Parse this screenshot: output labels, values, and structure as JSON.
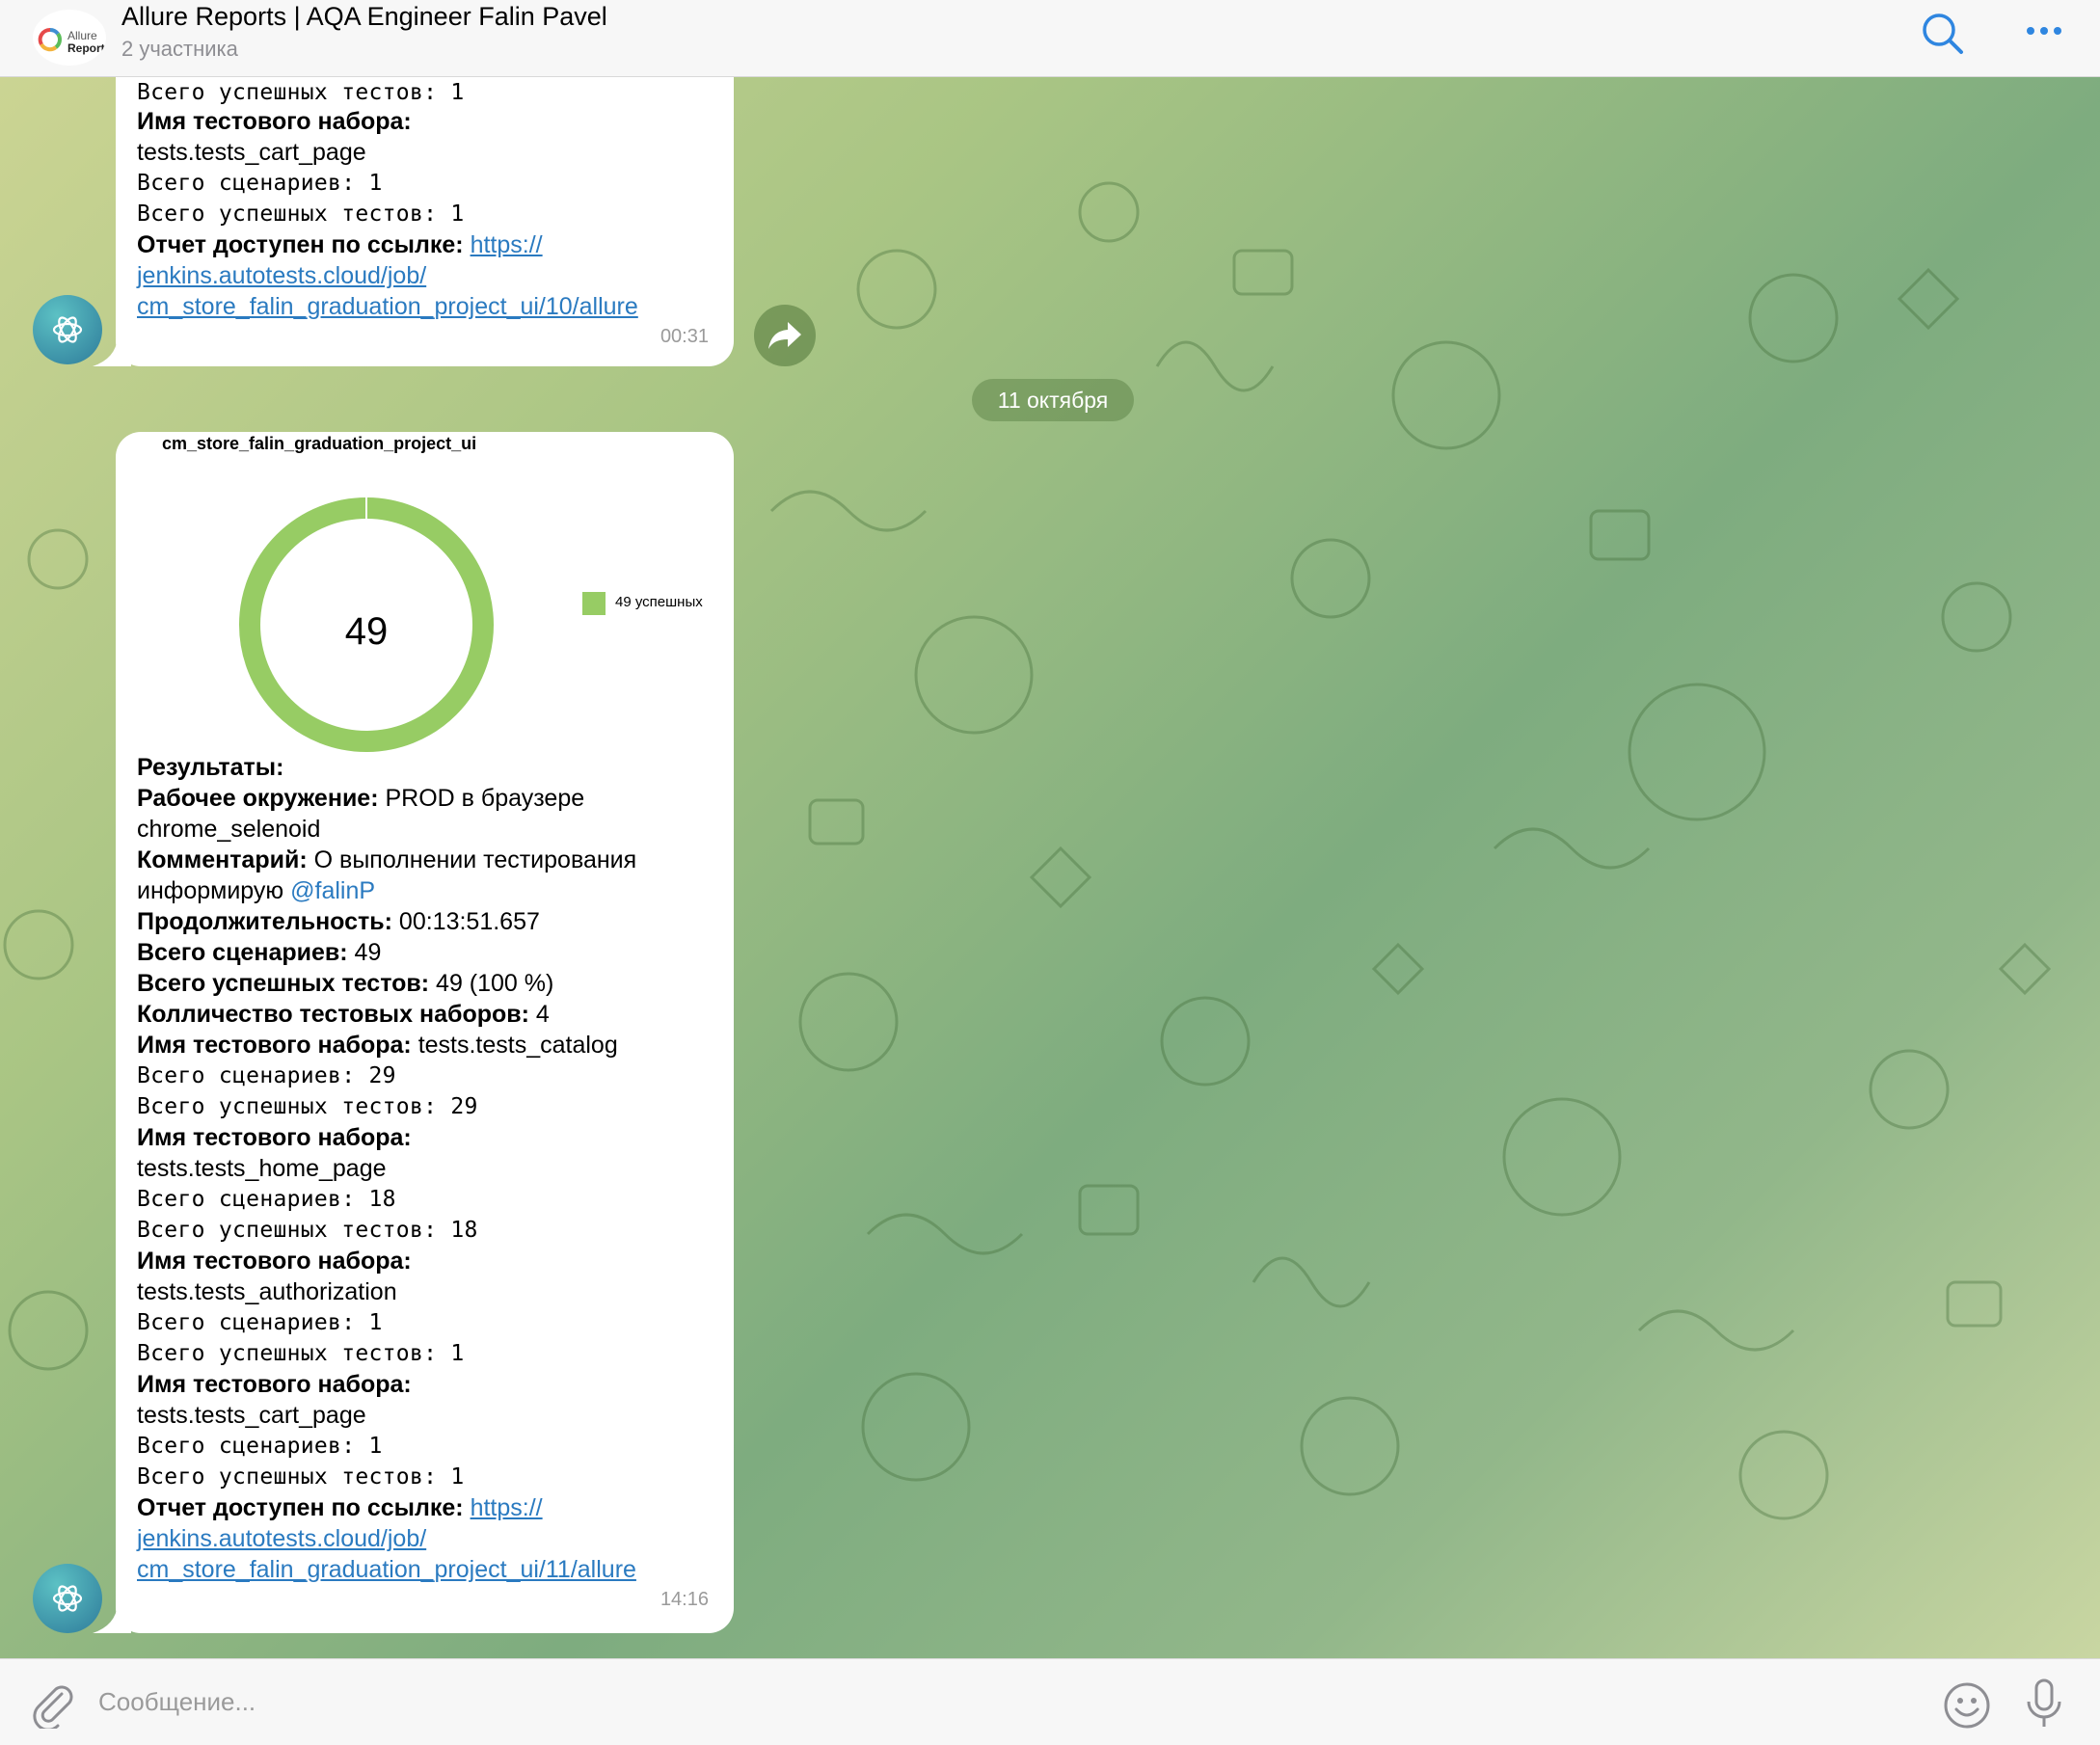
{
  "header": {
    "title": "Allure Reports | AQA Engineer Falin Pavel",
    "subtitle": "2 участника",
    "logo_text_1": "Allure",
    "logo_text_2": "Report",
    "search_icon": "search-icon",
    "more_icon": "more-icon"
  },
  "date_separator": "11 октября",
  "messages": [
    {
      "lines": [
        {
          "text": "Всего успешных тестов: 1"
        },
        {
          "label": "Имя тестового набора:"
        },
        {
          "text": "tests.tests_cart_page"
        },
        {
          "text": "Всего сценариев: 1"
        },
        {
          "text": "Всего успешных тестов: 1"
        },
        {
          "label": "Отчет доступен по ссылке:",
          "link": "https://"
        },
        {
          "link": "jenkins.autotests.cloud/job/"
        },
        {
          "link": "cm_store_falin_graduation_project_ui/10/allure"
        }
      ],
      "time": "00:31"
    },
    {
      "chart": {
        "title": "cm_store_falin_graduation_project_ui",
        "center_value": "49",
        "legend": "49 успешных"
      },
      "lines": [
        {
          "label": "Результаты:"
        },
        {
          "label": "Рабочее окружение:",
          "text": "PROD в браузере"
        },
        {
          "text": "chrome_selenoid"
        },
        {
          "label": "Комментарий:",
          "text": "О выполнении тестирования"
        },
        {
          "text": "информирую",
          "mention": "@falinP"
        },
        {
          "label": "Продолжительность:",
          "text": "00:13:51.657"
        },
        {
          "label": "Всего сценариев:",
          "text": "49"
        },
        {
          "label": "Всего успешных тестов:",
          "text": "49 (100 %)"
        },
        {
          "label": "Колличество тестовых наборов:",
          "text": "4"
        },
        {
          "label": "Имя тестового набора:",
          "text": "tests.tests_catalog"
        },
        {
          "text": "Всего сценариев: 29"
        },
        {
          "text": "Всего успешных тестов: 29"
        },
        {
          "label": "Имя тестового набора:"
        },
        {
          "text": "tests.tests_home_page"
        },
        {
          "text": "Всего сценариев: 18"
        },
        {
          "text": "Всего успешных тестов: 18"
        },
        {
          "label": "Имя тестового набора:"
        },
        {
          "text": "tests.tests_authorization"
        },
        {
          "text": "Всего сценариев: 1"
        },
        {
          "text": "Всего успешных тестов: 1"
        },
        {
          "label": "Имя тестового набора:"
        },
        {
          "text": "tests.tests_cart_page"
        },
        {
          "text": "Всего сценариев: 1"
        },
        {
          "text": "Всего успешных тестов: 1"
        },
        {
          "label": "Отчет доступен по ссылке:",
          "link": "https://"
        },
        {
          "link": "jenkins.autotests.cloud/job/"
        },
        {
          "link": "cm_store_falin_graduation_project_ui/11/allure"
        }
      ],
      "time": "14:16"
    }
  ],
  "chart_data": {
    "type": "pie",
    "title": "cm_store_falin_graduation_project_ui",
    "categories": [
      "49 успешных"
    ],
    "values": [
      49
    ],
    "colors": [
      "#97cc64"
    ]
  },
  "input": {
    "placeholder": "Сообщение..."
  },
  "colors": {
    "link": "#2a7ac0",
    "passed": "#97cc64",
    "header_bg": "#f7f7f7"
  }
}
